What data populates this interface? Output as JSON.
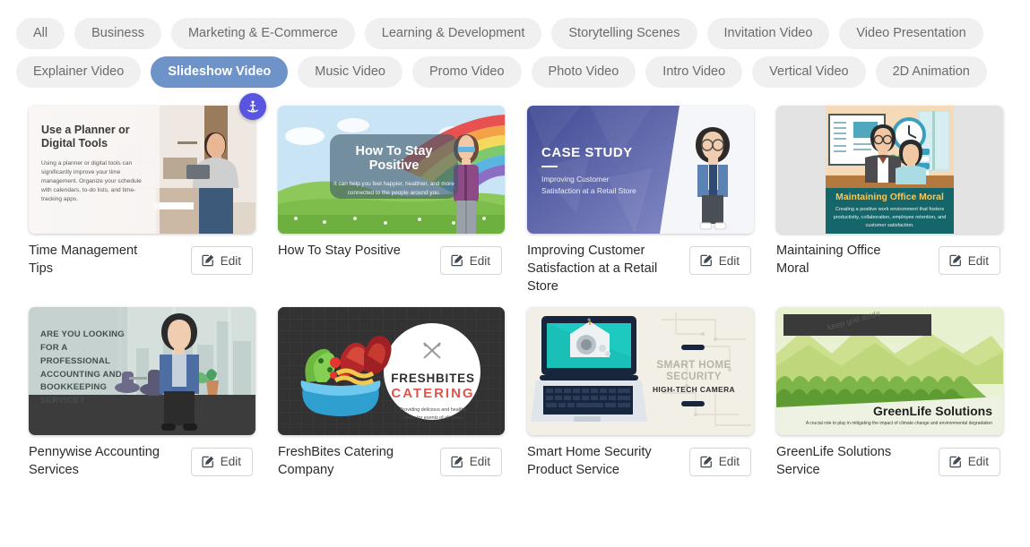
{
  "filters": {
    "row1": [
      {
        "label": "All",
        "active": false
      },
      {
        "label": "Business",
        "active": false
      },
      {
        "label": "Marketing & E-Commerce",
        "active": false
      },
      {
        "label": "Learning & Development",
        "active": false
      },
      {
        "label": "Storytelling Scenes",
        "active": false
      },
      {
        "label": "Invitation Video",
        "active": false
      },
      {
        "label": "Video Presentation",
        "active": false
      }
    ],
    "row2": [
      {
        "label": "Explainer Video",
        "active": false
      },
      {
        "label": "Slideshow Video",
        "active": true
      },
      {
        "label": "Music Video",
        "active": false
      },
      {
        "label": "Promo Video",
        "active": false
      },
      {
        "label": "Photo Video",
        "active": false
      },
      {
        "label": "Intro Video",
        "active": false
      },
      {
        "label": "Vertical Video",
        "active": false
      },
      {
        "label": "2D Animation",
        "active": false
      }
    ],
    "active_chip": "Slideshow Video",
    "colors": {
      "chip_bg": "#f0f0f0",
      "chip_text": "#6b6b6b",
      "active_bg": "#6e93c8",
      "active_text": "#ffffff",
      "badge_bg": "#5a55e0"
    }
  },
  "edit_label": "Edit",
  "cards": [
    {
      "title": "Time Management Tips",
      "edit": "Edit",
      "badge": "character-avatar-icon",
      "thumb": {
        "heading": "Use a Planner or Digital Tools",
        "body": "Using a planner or digital tools can significantly improve your time management. Organize your schedule with calendars, to-do lists, and time-tracking apps."
      }
    },
    {
      "title": "How To Stay Positive",
      "edit": "Edit",
      "thumb": {
        "heading": "How To Stay Positive",
        "body": "It can help you feel happier, healthier, and more connected to the people around you."
      }
    },
    {
      "title": "Improving Customer Satisfaction at a Retail Store",
      "edit": "Edit",
      "thumb": {
        "heading": "CASE STUDY",
        "body": "Improving Customer Satisfaction at a Retail Store"
      }
    },
    {
      "title": "Maintaining Office Moral",
      "edit": "Edit",
      "thumb": {
        "heading": "Maintaining Office Moral",
        "body": "Creating a positive work environment that fosters productivity, collaboration, employee retention, and customer satisfaction."
      }
    },
    {
      "title": "Pennywise Accounting Services",
      "edit": "Edit",
      "thumb": {
        "heading": "ARE YOU LOOKING FOR A PROFESSIONAL ACCOUNTING AND BOOKKEEPING SERVICE?",
        "body": ""
      }
    },
    {
      "title": "FreshBites Catering Company",
      "edit": "Edit",
      "thumb": {
        "heading": "FRESHBITES",
        "heading2": "CATERING",
        "body": "Providing delicious and healthy meals for events of all sizes."
      }
    },
    {
      "title": "Smart Home Security Product Service",
      "edit": "Edit",
      "thumb": {
        "heading": "SMART HOME SECURITY",
        "body": "HIGH-TECH CAMERA"
      }
    },
    {
      "title": "GreenLife Solutions Service",
      "edit": "Edit",
      "thumb": {
        "heading": "GreenLife Solutions",
        "body": "A crucial role to play in mitigating the impact of climate change and environmental degradation"
      }
    }
  ]
}
